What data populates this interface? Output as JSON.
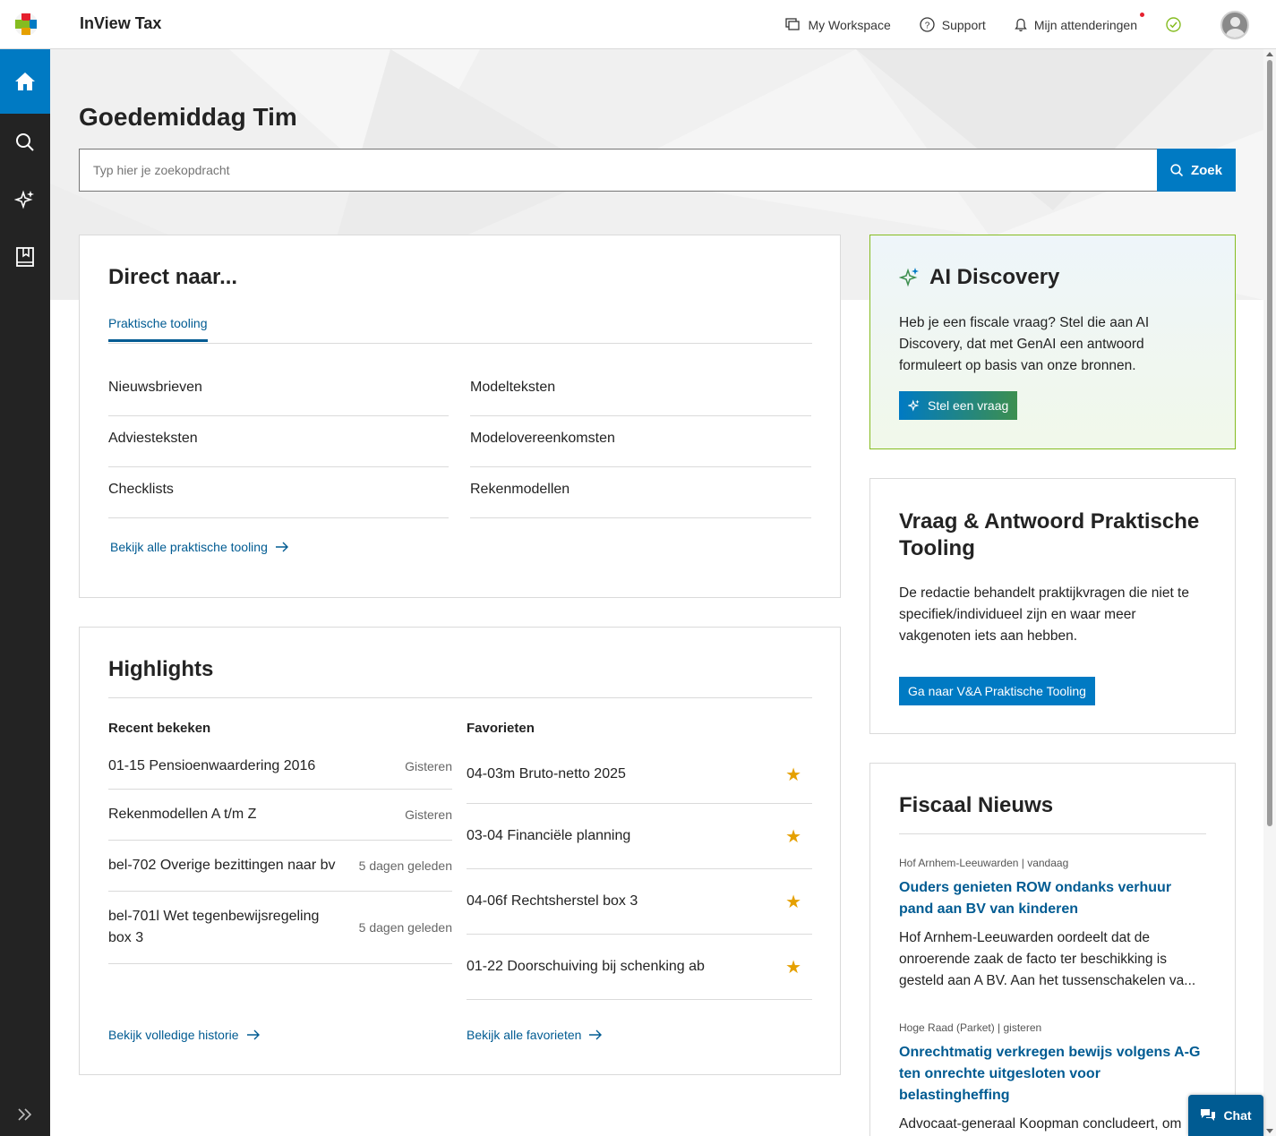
{
  "header": {
    "brand": "InView Tax",
    "nav": {
      "workspace": "My Workspace",
      "support": "Support",
      "alerts": "Mijn attenderingen"
    }
  },
  "hero": {
    "greeting": "Goedemiddag Tim",
    "search_placeholder": "Typ hier je zoekopdracht",
    "search_button": "Zoek"
  },
  "direct": {
    "title": "Direct naar...",
    "tab": "Praktische tooling",
    "left_links": [
      "Nieuwsbrieven",
      "Adviesteksten",
      "Checklists"
    ],
    "right_links": [
      "Modelteksten",
      "Modelovereenkomsten",
      "Rekenmodellen"
    ],
    "see_all": "Bekijk alle praktische tooling"
  },
  "highlights": {
    "title": "Highlights",
    "recent_title": "Recent bekeken",
    "favorites_title": "Favorieten",
    "recent": [
      {
        "label": "01-15 Pensioenwaardering 2016",
        "when": "Gisteren"
      },
      {
        "label": "Rekenmodellen A t/m Z",
        "when": "Gisteren"
      },
      {
        "label": "bel-702 Overige bezittingen naar bv",
        "when": "5 dagen geleden"
      },
      {
        "label": "bel-701l Wet tegenbewijsregeling box 3",
        "when": "5 dagen geleden"
      }
    ],
    "favorites": [
      "04-03m Bruto-netto 2025",
      "03-04 Financiële planning",
      "04-06f Rechtsherstel box 3",
      "01-22 Doorschuiving bij schenking ab"
    ],
    "history_link": "Bekijk volledige historie",
    "favorites_link": "Bekijk alle favorieten"
  },
  "ai": {
    "title": "AI Discovery",
    "text": "Heb je een fiscale vraag? Stel die aan AI Discovery, dat met GenAI een antwoord formuleert op basis van onze bronnen.",
    "button": "Stel een vraag"
  },
  "vna": {
    "title": "Vraag & Antwoord Praktische Tooling",
    "text": "De redactie behandelt praktijkvragen die niet te specifiek/individueel zijn en waar meer vakgenoten iets aan hebben.",
    "button": "Ga naar V&A Praktische Tooling"
  },
  "news": {
    "title": "Fiscaal Nieuws",
    "items": [
      {
        "meta": "Hof Arnhem-Leeuwarden | vandaag",
        "title": "Ouders genieten ROW ondanks verhuur pand aan BV van kinderen",
        "body": "Hof Arnhem-Leeuwarden oordeelt dat de onroerende zaak de facto ter beschikking is gesteld aan A BV. Aan het tussenschakelen va..."
      },
      {
        "meta": "Hoge Raad (Parket) | gisteren",
        "title": "Onrechtmatig verkregen bewijs volgens A-G ten onrechte uitgesloten voor belastingheffing",
        "body": "Advocaat-generaal Koopman concludeert, om andere redenen dan het hof, dat weliswaar"
      }
    ]
  },
  "chat": {
    "label": "Chat"
  },
  "colors": {
    "primary": "#007ac3",
    "link": "#005b92",
    "sidebar": "#232323",
    "star": "#e5a000",
    "ai_border": "#85bc20"
  }
}
